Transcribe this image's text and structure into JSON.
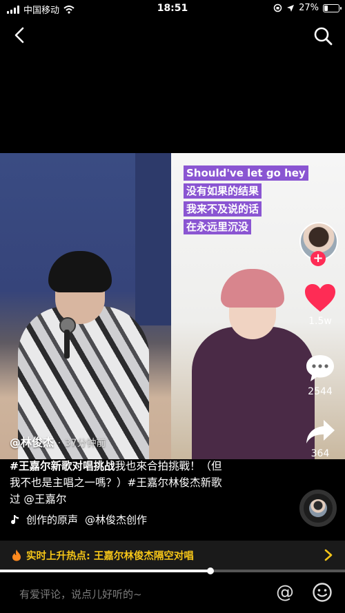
{
  "status_bar": {
    "carrier": "中国移动",
    "time": "18:51",
    "battery": "27%",
    "battery_level": 0.27
  },
  "lyrics": [
    "Should've let go hey",
    "没有如果的结果",
    "我来不及说的话",
    "在永远里沉没"
  ],
  "actions": {
    "likes": "1.5w",
    "comments": "2544",
    "shares": "364"
  },
  "post": {
    "author": "@林俊杰",
    "separator": "·",
    "time": "37分钟前",
    "caption_tag": "#王嘉尔新歌对唱挑战",
    "caption_rest_1": "我也來合拍挑戰！（但",
    "caption_line_2": "我不也是主唱之一嗎？）#王嘉尔林俊杰新歌",
    "caption_line_3": "过 @王嘉尔",
    "music_label": "创作的原声",
    "music_author": "@林俊杰创作"
  },
  "hot_topic": {
    "text": "实时上升热点: 王嘉尔林俊杰隔空对唱"
  },
  "playback": {
    "progress": 0.61
  },
  "comment": {
    "placeholder": "有爱评论，说点儿好听的~",
    "at_symbol": "@"
  },
  "colors": {
    "accent_red": "#fe2c55",
    "hot_yellow": "#f5c518",
    "lyric_purple": "#8a55d2"
  }
}
